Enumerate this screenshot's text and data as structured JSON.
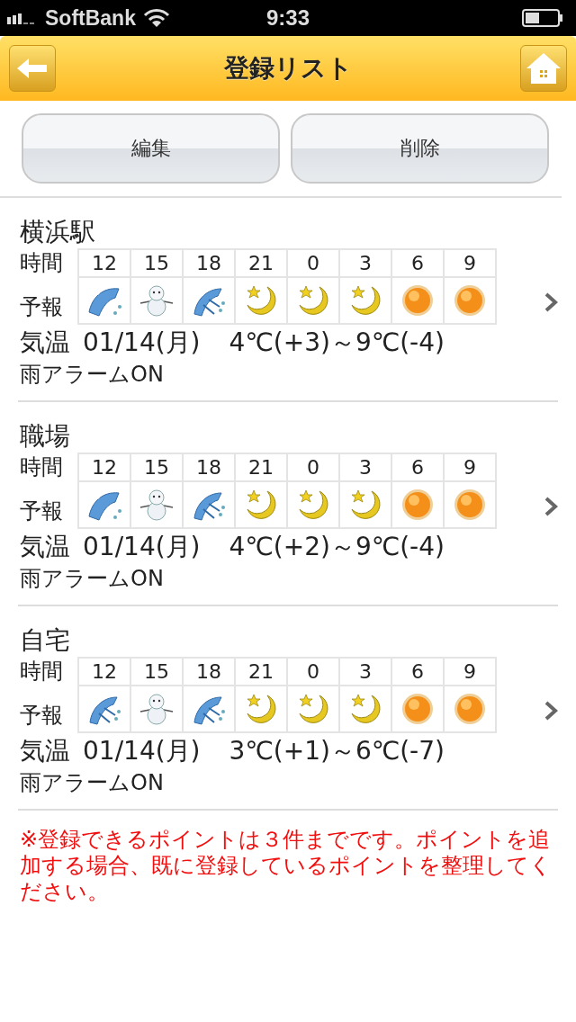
{
  "status_bar": {
    "carrier": "SoftBank",
    "time": "9:33"
  },
  "header": {
    "title": "登録リスト"
  },
  "actions": [
    "編集",
    "削除"
  ],
  "entries": [
    {
      "name": "横浜駅",
      "time_label": "時間",
      "forecast_label": "予報",
      "hours": [
        "12",
        "15",
        "18",
        "21",
        "0",
        "3",
        "6",
        "9"
      ],
      "forecast": [
        {
          "kind": "sleet"
        },
        {
          "kind": "snowman"
        },
        {
          "kind": "rain"
        },
        {
          "kind": "moon"
        },
        {
          "kind": "moon"
        },
        {
          "kind": "moon"
        },
        {
          "kind": "sun"
        },
        {
          "kind": "sun"
        }
      ],
      "temp_label": "気温",
      "date": "01/14(月)",
      "temps": "4℃(+3)～9℃(-4)",
      "alarm": "雨アラームON"
    },
    {
      "name": "職場",
      "time_label": "時間",
      "forecast_label": "予報",
      "hours": [
        "12",
        "15",
        "18",
        "21",
        "0",
        "3",
        "6",
        "9"
      ],
      "forecast": [
        {
          "kind": "sleet"
        },
        {
          "kind": "snowman"
        },
        {
          "kind": "rain"
        },
        {
          "kind": "moon"
        },
        {
          "kind": "moon"
        },
        {
          "kind": "moon"
        },
        {
          "kind": "sun"
        },
        {
          "kind": "sun"
        }
      ],
      "temp_label": "気温",
      "date": "01/14(月)",
      "temps": "4℃(+2)～9℃(-4)",
      "alarm": "雨アラームON"
    },
    {
      "name": "自宅",
      "time_label": "時間",
      "forecast_label": "予報",
      "hours": [
        "12",
        "15",
        "18",
        "21",
        "0",
        "3",
        "6",
        "9"
      ],
      "forecast": [
        {
          "kind": "rain"
        },
        {
          "kind": "snowman"
        },
        {
          "kind": "rain"
        },
        {
          "kind": "moon"
        },
        {
          "kind": "moon"
        },
        {
          "kind": "moon"
        },
        {
          "kind": "sun"
        },
        {
          "kind": "sun"
        }
      ],
      "temp_label": "気温",
      "date": "01/14(月)",
      "temps": "3℃(+1)～6℃(-7)",
      "alarm": "雨アラームON"
    }
  ],
  "notice": "※登録できるポイントは３件までです。ポイントを追加する場合、既に登録しているポイントを整理してください。"
}
